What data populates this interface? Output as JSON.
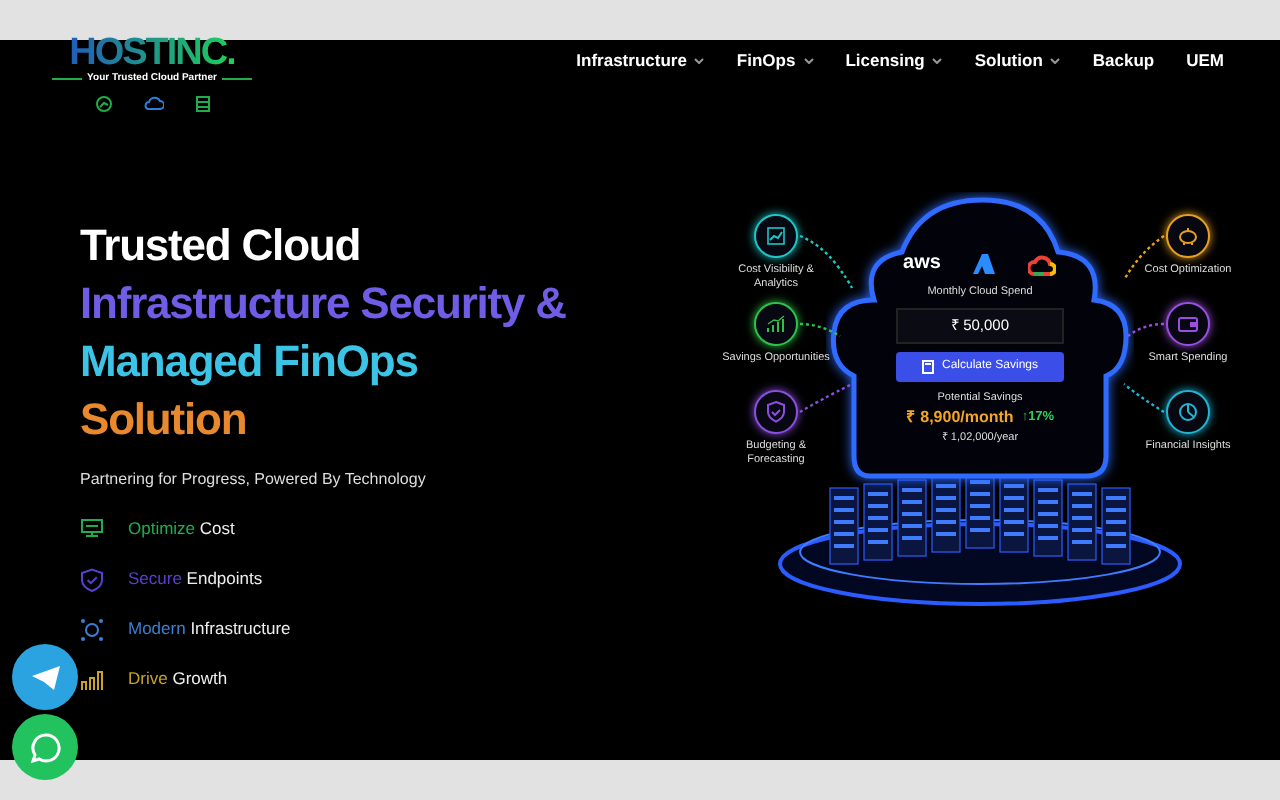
{
  "logo": {
    "wordmark": "HOSTINC.",
    "tagline": "Your Trusted Cloud Partner"
  },
  "nav": [
    {
      "label": "Infrastructure",
      "dropdown": true
    },
    {
      "label": "FinOps",
      "dropdown": true
    },
    {
      "label": "Licensing",
      "dropdown": true
    },
    {
      "label": "Solution",
      "dropdown": true
    },
    {
      "label": "Backup",
      "dropdown": false
    },
    {
      "label": "UEM",
      "dropdown": false
    }
  ],
  "hero": {
    "heading": [
      {
        "text": "Trusted Cloud",
        "color": "#ffffff"
      },
      {
        "text": "Infrastructure Security &",
        "color": "#6f5de6"
      },
      {
        "text": "Managed FinOps",
        "color": "#3cc4e6"
      },
      {
        "text": "Solution",
        "color": "#e8892e"
      }
    ],
    "subtitle": "Partnering for Progress, Powered By Technology",
    "features": [
      {
        "kind": "cost",
        "highlight": "Optimize",
        "text": "Cost",
        "color": "#1fae4a"
      },
      {
        "kind": "shield",
        "highlight": "Secure",
        "text": "Endpoints",
        "color": "#5b3fd0"
      },
      {
        "kind": "network",
        "highlight": "Modern",
        "text": "Infrastructure",
        "color": "#3b7fd6"
      },
      {
        "kind": "growth",
        "highlight": "Drive",
        "text": "Growth",
        "color": "#c9a227"
      }
    ]
  },
  "illustration": {
    "left_items": [
      {
        "kind": "chart",
        "label": "Cost Visibility & Analytics",
        "color": "#1fc6c6"
      },
      {
        "kind": "growth",
        "label": "Savings Opportunities",
        "color": "#2fc24a"
      },
      {
        "kind": "shield",
        "label": "Budgeting & Forecasting",
        "color": "#8a4fe0"
      }
    ],
    "right_items": [
      {
        "kind": "piggy",
        "label": "Cost Optimization",
        "color": "#e8a11f"
      },
      {
        "kind": "wallet",
        "label": "Smart Spending",
        "color": "#9a4fe0"
      },
      {
        "kind": "pie",
        "label": "Financial Insights",
        "color": "#1fb6d6"
      }
    ],
    "provider": "aws",
    "spend_label": "Monthly Cloud Spend",
    "spend": "₹ 50,000",
    "button": "Calculate Savings",
    "savings_label": "Potential Savings",
    "monthly": "₹ 8,900/month",
    "change": "↑17%",
    "yearly": "₹ 1,02,000/year"
  }
}
